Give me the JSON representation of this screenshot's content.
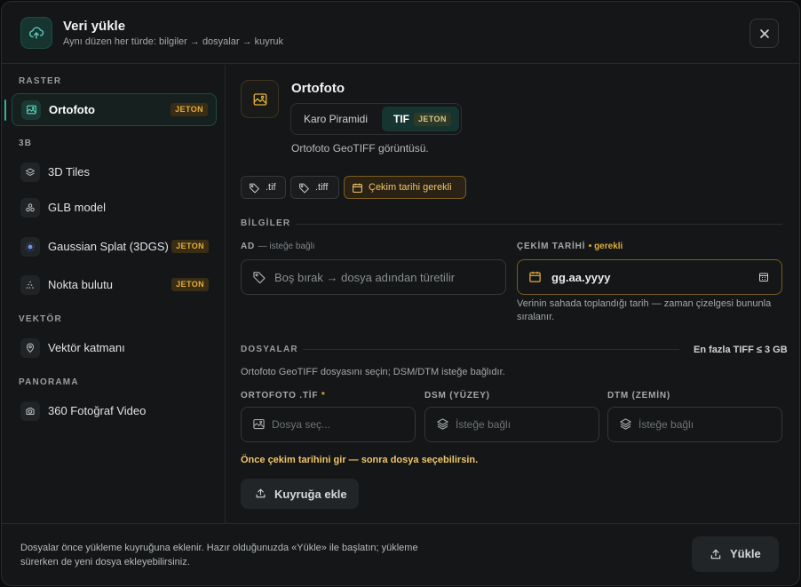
{
  "header": {
    "title": "Veri yükle",
    "subtitle": "Aynı düzen her türde: bilgiler → dosyalar → kuyruk",
    "icon": "cloud-upload-icon"
  },
  "sidebar": {
    "sections": [
      {
        "label": "RASTER"
      },
      {
        "label": "3B"
      },
      {
        "label": "VEKTÖR"
      },
      {
        "label": "PANORAMA"
      }
    ],
    "items": [
      {
        "label": "Ortofoto",
        "badge": "JETON",
        "icon": "image-icon",
        "active": true
      },
      {
        "label": "3D Tiles",
        "icon": "layers-3d-icon"
      },
      {
        "label": "GLB model",
        "icon": "molecule-icon"
      },
      {
        "label": "Gaussian Splat (3DGS)",
        "badge": "JETON",
        "icon": "splat-icon"
      },
      {
        "label": "Nokta bulutu",
        "badge": "JETON",
        "icon": "point-cloud-icon"
      },
      {
        "label": "Vektör katmanı",
        "icon": "map-pin-icon"
      },
      {
        "label": "360 Fotoğraf Video",
        "icon": "camera-icon"
      }
    ]
  },
  "main": {
    "type_title": "Ortofoto",
    "segments": [
      {
        "label": "Karo Piramidi"
      },
      {
        "label": "TIF",
        "badge": "JETON",
        "selected": true
      }
    ],
    "description": "Ortofoto GeoTIFF görüntüsü.",
    "chips": [
      {
        "label": ".tif"
      },
      {
        "label": ".tiff"
      },
      {
        "label": "Çekim tarihi gerekli"
      }
    ],
    "info_section": "BİLGİLER",
    "name_label": "AD",
    "name_optional": "— isteğe bağlı",
    "name_placeholder": "Boş bırak → dosya adından türetilir",
    "date_label": "ÇEKİM TARİHİ",
    "date_required": "• gerekli",
    "date_value": "gg.aa.yyyy",
    "date_hint": "Verinin sahada toplandığı tarih — zaman çizelgesi bununla sıralanır.",
    "files_section": "DOSYALAR",
    "files_limit": "En fazla TIFF ≤ 3 GB",
    "files_desc": "Ortofoto GeoTIFF dosyasını seçin; DSM/DTM isteğe bağlıdır.",
    "ortho_label": "ORTOFOTO .TİF",
    "ortho_required": "*",
    "ortho_placeholder": "Dosya seç...",
    "dsm_label": "DSM (YÜZEY)",
    "dsm_placeholder": "İsteğe bağlı",
    "dtm_label": "DTM (ZEMİN)",
    "dtm_placeholder": "İsteğe bağlı",
    "warning": "Önce çekim tarihini gir — sonra dosya seçebilirsin.",
    "queue_button": "Kuyruğa ekle"
  },
  "footer": {
    "text": "Dosyalar önce yükleme kuyruğuna eklenir. Hazır olduğunuzda «Yükle» ile başlatın; yükleme sürerken de yeni dosya ekleyebilirsiniz.",
    "upload_button": "Yükle"
  },
  "colors": {
    "accent": "#2fb39c",
    "warning": "#e0ad3c",
    "background": "#141617"
  }
}
